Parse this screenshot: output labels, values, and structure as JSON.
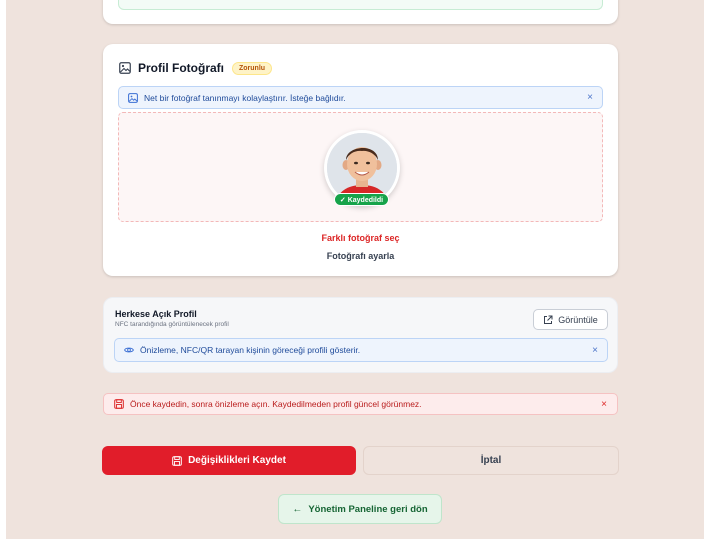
{
  "photo_section": {
    "title": "Profil Fotoğrafı",
    "badge": "Zorunlu",
    "info": "Net bir fotoğraf tanınmayı kolaylaştırır. İsteğe bağlıdır.",
    "close_symbol": "×",
    "saved_badge": "✓ Kaydedildi",
    "change_link": "Farklı fotoğraf seç",
    "adjust_link": "Fotoğrafı ayarla",
    "icons": [
      "image-icon",
      "info-icon",
      "close-icon"
    ]
  },
  "public_profile": {
    "title": "Herkese Açık Profil",
    "subtitle": "NFC tarandığında görüntülenecek profil",
    "view_button": "Görüntüle",
    "info": "Önizleme, NFC/QR tarayan kişinin göreceği profili gösterir.",
    "close_symbol": "×",
    "icons": [
      "external-link-icon",
      "eye-icon",
      "close-icon"
    ]
  },
  "error": {
    "text": "Önce kaydedin, sonra önizleme açın. Kaydedilmeden profil güncel görünmez.",
    "close_symbol": "×",
    "icon": "save-icon"
  },
  "actions": {
    "save_label": "Değişiklikleri Kaydet",
    "cancel_label": "İptal",
    "back_label": "Yönetim Paneline geri dön",
    "back_arrow": "←"
  },
  "colors": {
    "background": "#efe3dd",
    "primary_red": "#e11d2a",
    "success_green": "#16a34a",
    "info_blue": "#1e4a9a",
    "warning_amber": "#b45309"
  }
}
